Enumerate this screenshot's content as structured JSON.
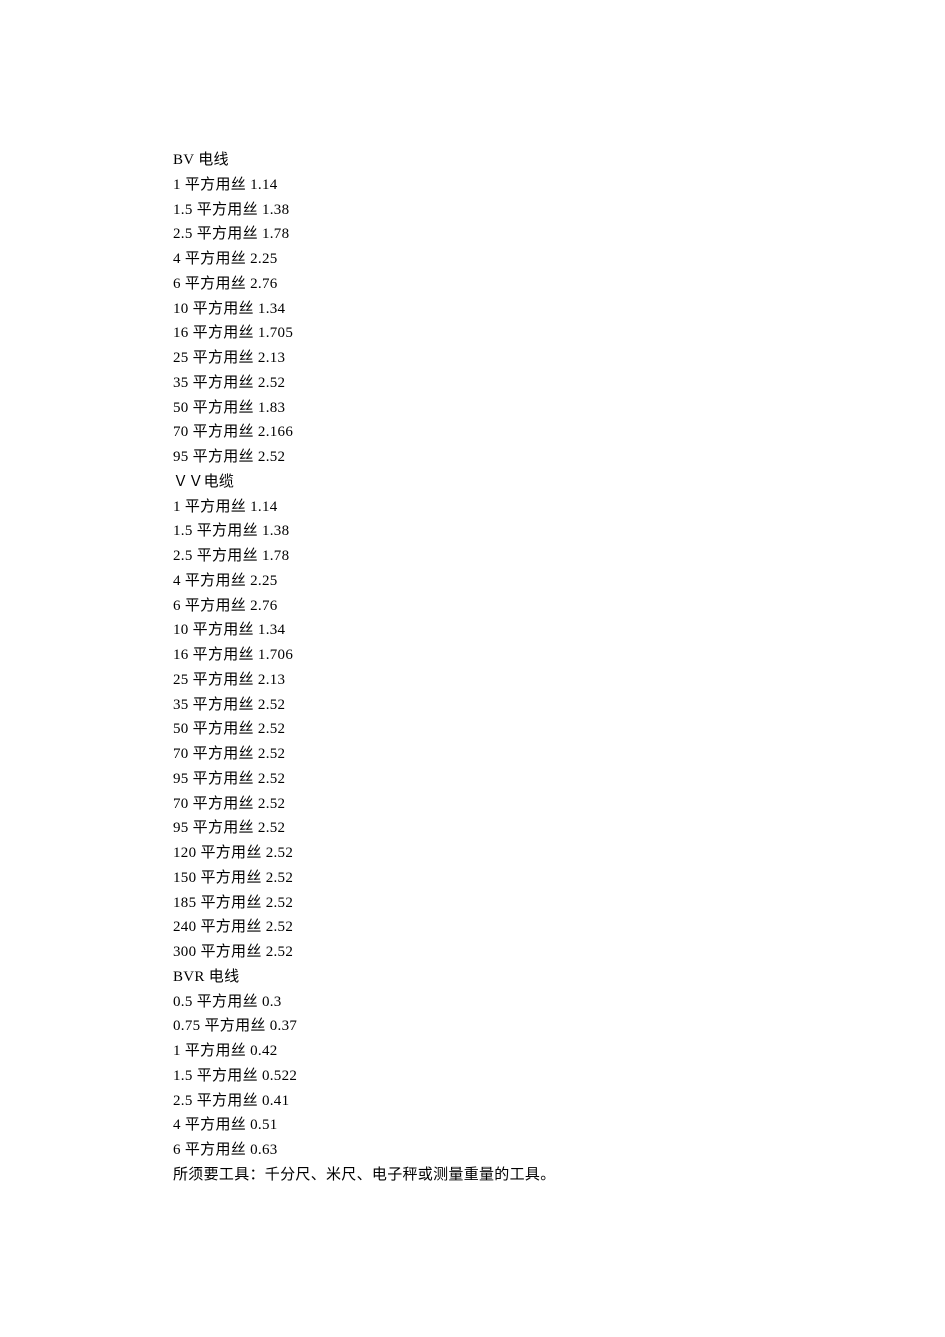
{
  "sections": [
    {
      "heading": "BV 电线",
      "items": [
        "1 平方用丝 1.14",
        "1.5 平方用丝 1.38",
        "2.5 平方用丝 1.78",
        "4 平方用丝 2.25",
        "6 平方用丝 2.76",
        "10 平方用丝 1.34",
        "16 平方用丝 1.705",
        "25 平方用丝 2.13",
        "35 平方用丝 2.52",
        "50 平方用丝 1.83",
        "70 平方用丝 2.166",
        "95 平方用丝 2.52"
      ]
    },
    {
      "heading": "ＶＶ电缆",
      "items": [
        "1 平方用丝 1.14",
        "1.5 平方用丝 1.38",
        "2.5 平方用丝 1.78",
        "4 平方用丝 2.25",
        "6 平方用丝 2.76",
        "10 平方用丝 1.34",
        "16 平方用丝 1.706",
        "25 平方用丝 2.13",
        "35 平方用丝 2.52",
        "50 平方用丝 2.52",
        "70 平方用丝 2.52",
        "95 平方用丝 2.52",
        "70 平方用丝 2.52",
        "95 平方用丝 2.52",
        "120 平方用丝 2.52",
        "150 平方用丝 2.52",
        "185 平方用丝 2.52",
        "240 平方用丝 2.52",
        "300 平方用丝 2.52"
      ]
    },
    {
      "heading": "BVR 电线",
      "items": [
        "0.5 平方用丝 0.3",
        "0.75 平方用丝 0.37",
        "1 平方用丝 0.42",
        "1.5 平方用丝 0.522",
        "2.5 平方用丝 0.41",
        "4 平方用丝 0.51",
        "6 平方用丝 0.63"
      ]
    }
  ],
  "footer": "所须要工具：千分尺、米尺、电子秤或测量重量的工具。"
}
